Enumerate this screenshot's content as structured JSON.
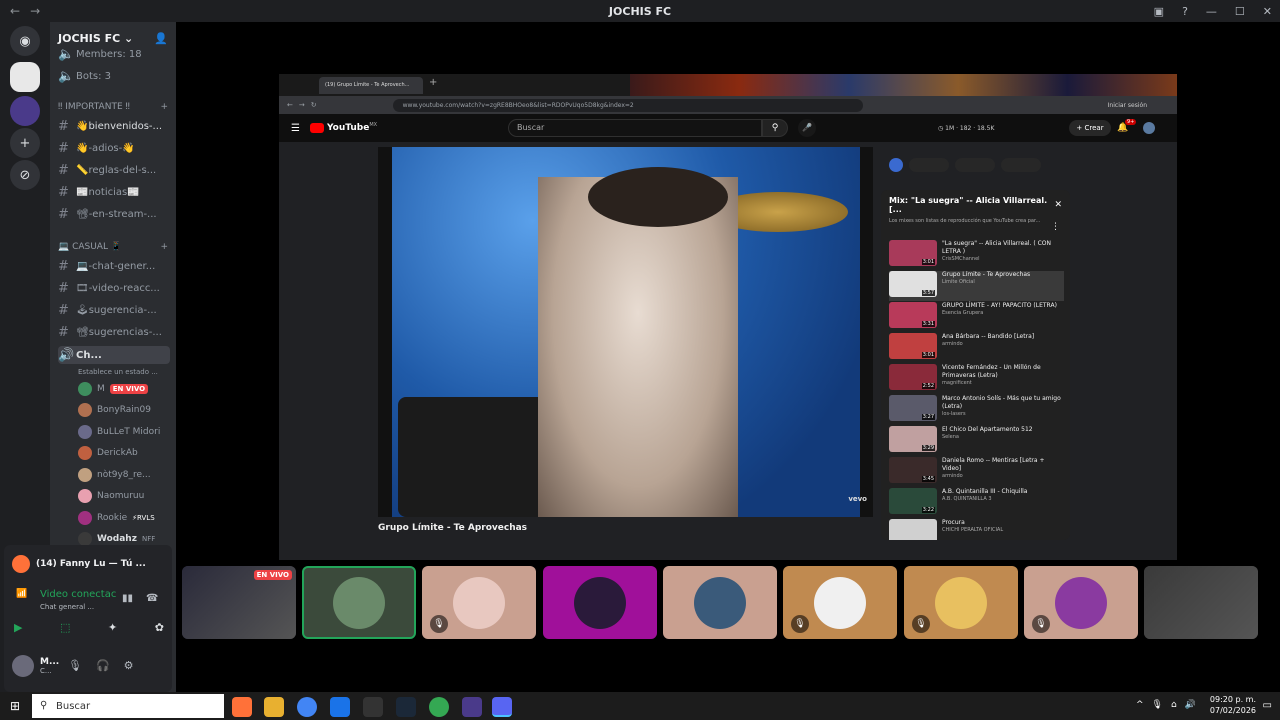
{
  "window": {
    "title": "JOCHIS FC",
    "back": "←",
    "forward": "→"
  },
  "guild": {
    "name": "JOCHIS FC ⌄",
    "members_stat": "Members: 18",
    "bots_stat": "Bots: 3"
  },
  "categories": {
    "important": "‼ IMPORTANTE ‼",
    "casual": "💻 CASUAL 📱"
  },
  "channels": [
    {
      "label": "👋bienvenidos-..."
    },
    {
      "label": "👋-adios-👋"
    },
    {
      "label": "📏reglas-del-s..."
    },
    {
      "label": "📰noticias📰"
    },
    {
      "label": "📽-en-stream-..."
    },
    {
      "label": "💻-chat-gener..."
    },
    {
      "label": "🎞-video-reacc..."
    },
    {
      "label": "🕹sugerencia-..."
    },
    {
      "label": "📽sugerencias-..."
    }
  ],
  "voice_channel": {
    "name": "Ch...",
    "status": "Establece un estado ..."
  },
  "voice_users": [
    {
      "name": "M",
      "live": "EN VIVO",
      "color": "#3e8e5e"
    },
    {
      "name": "BonyRain09",
      "color": "#b07050"
    },
    {
      "name": "BuLLeT Midori",
      "color": "#6a6a8a"
    },
    {
      "name": "DerickAb",
      "color": "#c06040"
    },
    {
      "name": "nòt9y8_re...",
      "color": "#c0a080"
    },
    {
      "name": "Naomuruu",
      "color": "#e8a0b0"
    },
    {
      "name": "Rookie",
      "tag": "⚡RVLS",
      "color": "#a03080"
    },
    {
      "name": "Wodahz",
      "tag": "NFF",
      "color": "#3a3a3a"
    }
  ],
  "user_panel": {
    "activity": "(14) Fanny Lu — Tú ...",
    "video_status": "Video conectac",
    "video_channel": "Chat general ...",
    "username": "M...",
    "user_sub": "C..."
  },
  "browser": {
    "tab_title": "(19) Grupo Límite - Te Aprovech...",
    "url": "www.youtube.com/watch?v=zgRE8BHOeo8&list=RDOPvUqo5D8kg&index=2",
    "signin": "Iniciar sesión"
  },
  "youtube": {
    "logo": "YouTube",
    "logo_region": "MX",
    "search_placeholder": "Buscar",
    "create": "+ Crear",
    "notif_count": "9+",
    "stats": [
      "1M",
      "182",
      "18.5K"
    ],
    "video_title": "Grupo Límite - Te Aprovechas",
    "watermark": "vevo"
  },
  "playlist": {
    "title": "Mix: \"La suegra\" -- Alicia Villarreal. [...",
    "subtitle": "Los mixes son listas de reproducción que YouTube crea par...",
    "items": [
      {
        "title": "\"La suegra\" -- Alicia Villarreal. ( CON LETRA )",
        "channel": "CrisSMChannel",
        "duration": "3:01",
        "color": "#a83a5a"
      },
      {
        "title": "Grupo Límite - Te Aprovechas",
        "channel": "Límite Oficial",
        "duration": "3:57",
        "color": "#e0e0e0"
      },
      {
        "title": "GRUPO LÍMITE - AY! PAPACITO (LETRA)",
        "channel": "Esencia Grupera",
        "duration": "3:31",
        "color": "#b83a5a"
      },
      {
        "title": "Ana Bárbara -- Bandido [Letra]",
        "channel": "armindo",
        "duration": "3:01",
        "color": "#c04040"
      },
      {
        "title": "Vicente Fernández - Un Millón de Primaveras (Letra)",
        "channel": "magnificent",
        "duration": "2:52",
        "color": "#8a2a3a"
      },
      {
        "title": "Marco Antonio Solís - Más que tu amigo (Letra)",
        "channel": "los-lasers",
        "duration": "3:27",
        "color": "#5a5a6a"
      },
      {
        "title": "El Chico Del Apartamento 512",
        "channel": "Selena",
        "duration": "3:29",
        "color": "#c0a0a0"
      },
      {
        "title": "Daniela Romo -- Mentiras [Letra + Video]",
        "channel": "armindo",
        "duration": "3:45",
        "color": "#3a2a2a"
      },
      {
        "title": "A.B. Quintanilla III - Chiquilla",
        "channel": "A.B. QUINTANILLA 3",
        "duration": "3:22",
        "color": "#2a4a3a"
      },
      {
        "title": "Procura",
        "channel": "CHICHI PERALTA OFICIAL",
        "duration": "",
        "color": "#d0d0d0"
      }
    ]
  },
  "tiles": [
    {
      "live": "EN VIVO",
      "bg": "#2a2a3a",
      "ava": "",
      "muted": false
    },
    {
      "bg": "#3b4a3b",
      "ava": "#6a8a6a",
      "muted": false
    },
    {
      "bg": "#c9a090",
      "ava": "#e8c8c0",
      "muted": true
    },
    {
      "bg": "#a0109a",
      "ava": "#2a1a3a",
      "muted": false
    },
    {
      "bg": "#c9a090",
      "ava": "#3a5a7a",
      "muted": false
    },
    {
      "bg": "#c08a50",
      "ava": "#f0f0f0",
      "muted": true
    },
    {
      "bg": "#c08a50",
      "ava": "#e8c060",
      "muted": true
    },
    {
      "bg": "#c9a090",
      "ava": "#8a3aa0",
      "muted": true
    },
    {
      "bg": "#3a3a3a",
      "ava": "",
      "muted": false
    }
  ],
  "taskbar": {
    "search": "Buscar",
    "time": "09:20 p. m.",
    "date": "07/02/2026"
  }
}
